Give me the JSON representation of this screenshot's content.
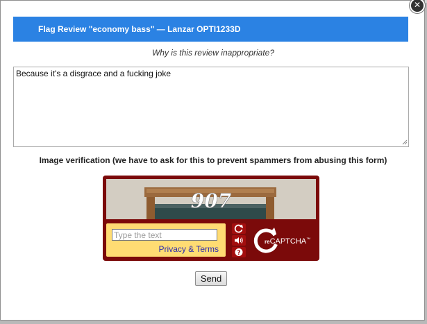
{
  "dialog": {
    "title": "Flag Review \"economy bass\" — Lanzar OPTI1233D",
    "close_label": "✕",
    "question": "Why is this review inappropriate?",
    "reason_text": "Because it's a disgrace and a fucking joke",
    "verification_label": "Image verification (we have to ask for this to prevent spammers from abusing this form)",
    "send_label": "Send"
  },
  "captcha": {
    "image_text": "907",
    "placeholder": "Type the text",
    "privacy_terms": "Privacy & Terms",
    "brand_prefix": "re",
    "brand_name": "CAPTCHA",
    "trademark": "™",
    "icons": [
      "refresh-icon",
      "audio-icon",
      "help-icon",
      "recaptcha-logo-icon"
    ],
    "colors": {
      "frame": "#7b0a0a",
      "button": "#a30e0e",
      "panel": "#ffdc73",
      "link": "#2a2ab0"
    }
  },
  "colors": {
    "titlebar": "#2b82e3"
  }
}
